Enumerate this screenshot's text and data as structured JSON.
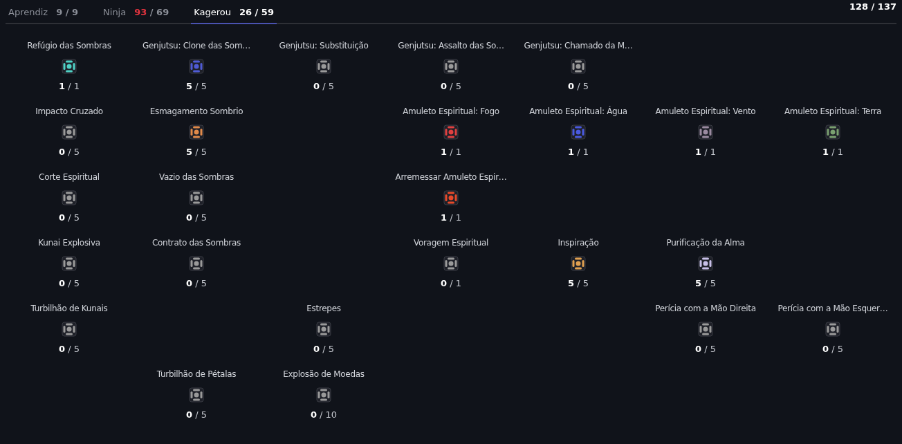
{
  "tabs": [
    {
      "label": "Aprendiz",
      "points": "9",
      "max": "/ 9",
      "selected": false
    },
    {
      "label": "Ninja",
      "points": "93",
      "max": "/ 69",
      "selected": false
    },
    {
      "label": "Kagerou",
      "points": "26",
      "max": "/ 59",
      "selected": true
    }
  ],
  "total": {
    "points": "128",
    "max": "/ 137"
  },
  "rows": [
    [
      {
        "name": "Refúgio das Sombras",
        "points": "1",
        "max": "/ 1",
        "color": "#4fd1c5"
      },
      {
        "name": "Genjutsu: Clone das Som…",
        "points": "5",
        "max": "/ 5",
        "color": "#4f5bd5"
      },
      {
        "name": "Genjutsu: Substituição",
        "points": "0",
        "max": "/ 5",
        "color": "#9a9a9a"
      },
      {
        "name": "Genjutsu: Assalto das So…",
        "points": "0",
        "max": "/ 5",
        "color": "#9a9a9a"
      },
      {
        "name": "Genjutsu: Chamado da M…",
        "points": "0",
        "max": "/ 5",
        "color": "#9a9a9a"
      },
      null,
      null
    ],
    [
      {
        "name": "Impacto Cruzado",
        "points": "0",
        "max": "/ 5",
        "color": "#9a9a9a"
      },
      {
        "name": "Esmagamento Sombrio",
        "points": "5",
        "max": "/ 5",
        "color": "#e08a4a"
      },
      null,
      {
        "name": "Amuleto Espiritual: Fogo",
        "points": "1",
        "max": "/ 1",
        "color": "#e04040"
      },
      {
        "name": "Amuleto Espiritual: Água",
        "points": "1",
        "max": "/ 1",
        "color": "#4a5ae0"
      },
      {
        "name": "Amuleto Espiritual: Vento",
        "points": "1",
        "max": "/ 1",
        "color": "#9a8aa0"
      },
      {
        "name": "Amuleto Espiritual: Terra",
        "points": "1",
        "max": "/ 1",
        "color": "#7aa070"
      }
    ],
    [
      {
        "name": "Corte Espiritual",
        "points": "0",
        "max": "/ 5",
        "color": "#9a9a9a"
      },
      {
        "name": "Vazio das Sombras",
        "points": "0",
        "max": "/ 5",
        "color": "#9a9a9a"
      },
      null,
      {
        "name": "Arremessar Amuleto Espir…",
        "points": "1",
        "max": "/ 1",
        "color": "#e84a2a"
      },
      null,
      null,
      null
    ],
    [
      {
        "name": "Kunai Explosiva",
        "points": "0",
        "max": "/ 5",
        "color": "#9a9a9a"
      },
      {
        "name": "Contrato das Sombras",
        "points": "0",
        "max": "/ 5",
        "color": "#9a9a9a"
      },
      null,
      {
        "name": "Voragem Espiritual",
        "points": "0",
        "max": "/ 1",
        "color": "#9a9a9a"
      },
      {
        "name": "Inspiração",
        "points": "5",
        "max": "/ 5",
        "color": "#e0a050"
      },
      {
        "name": "Purificação da Alma",
        "points": "5",
        "max": "/ 5",
        "color": "#c8c0e8"
      },
      null
    ],
    [
      {
        "name": "Turbilhão de Kunais",
        "points": "0",
        "max": "/ 5",
        "color": "#9a9a9a"
      },
      null,
      {
        "name": "Estrepes",
        "points": "0",
        "max": "/ 5",
        "color": "#9a9a9a"
      },
      null,
      null,
      {
        "name": "Perícia com a Mão Direita",
        "points": "0",
        "max": "/ 5",
        "color": "#9a9a9a"
      },
      {
        "name": "Perícia com a Mão Esquer…",
        "points": "0",
        "max": "/ 5",
        "color": "#9a9a9a"
      }
    ],
    [
      null,
      {
        "name": "Turbilhão de Pétalas",
        "points": "0",
        "max": "/ 5",
        "color": "#9a9a9a"
      },
      {
        "name": "Explosão de Moedas",
        "points": "0",
        "max": "/ 10",
        "color": "#9a9a9a"
      },
      null,
      null,
      null,
      null
    ]
  ]
}
